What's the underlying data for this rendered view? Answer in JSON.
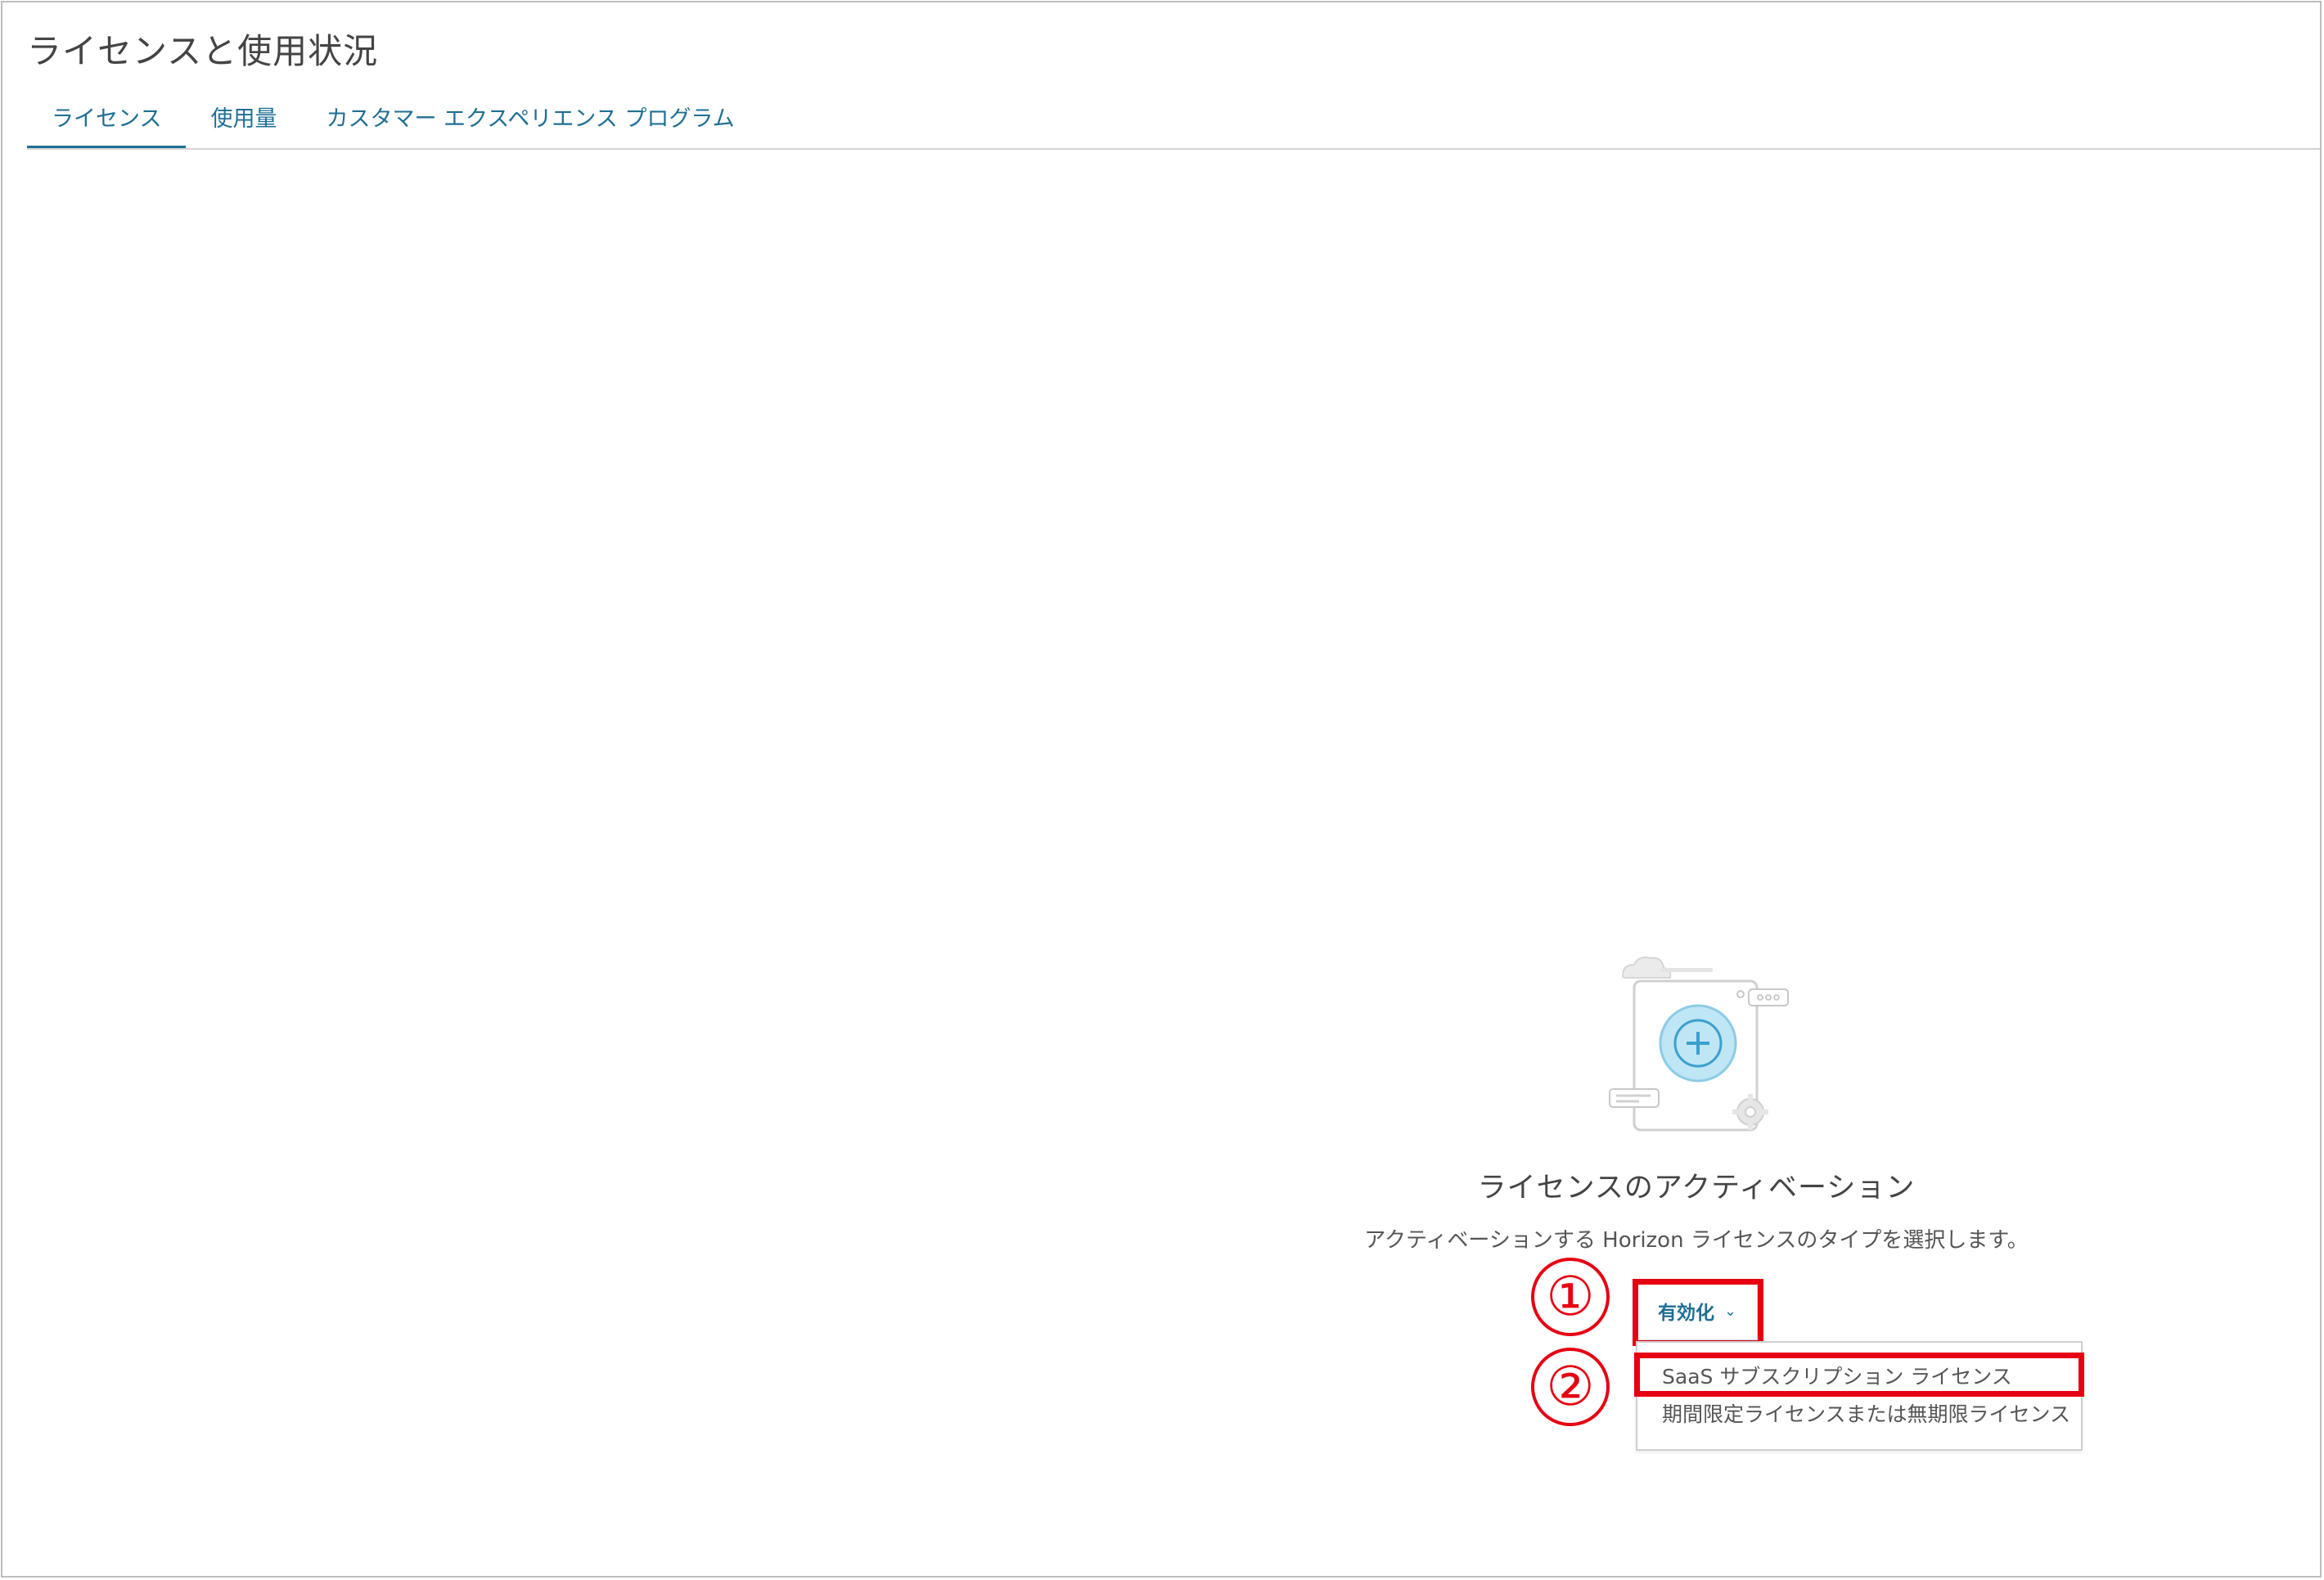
{
  "page": {
    "title": "ライセンスと使用状況"
  },
  "tabs": [
    {
      "label": "ライセンス",
      "active": true
    },
    {
      "label": "使用量",
      "active": false
    },
    {
      "label": "カスタマー エクスペリエンス プログラム",
      "active": false
    }
  ],
  "empty_state": {
    "illustration_icon": "license-add-illustration-icon",
    "title": "ライセンスのアクティベーション",
    "description": "アクティベーションする Horizon ライセンスのタイプを選択します。"
  },
  "activate_dropdown": {
    "label": "有効化",
    "chevron_icon": "chevron-down-icon",
    "options": [
      "SaaS サブスクリプション ライセンス",
      "期間限定ライセンスまたは無期限ライセンス"
    ]
  },
  "annotations": {
    "step1": "①",
    "step2": "②",
    "highlight_color": "#e60012"
  },
  "colors": {
    "accent": "#1f6f94",
    "text": "#444444"
  }
}
